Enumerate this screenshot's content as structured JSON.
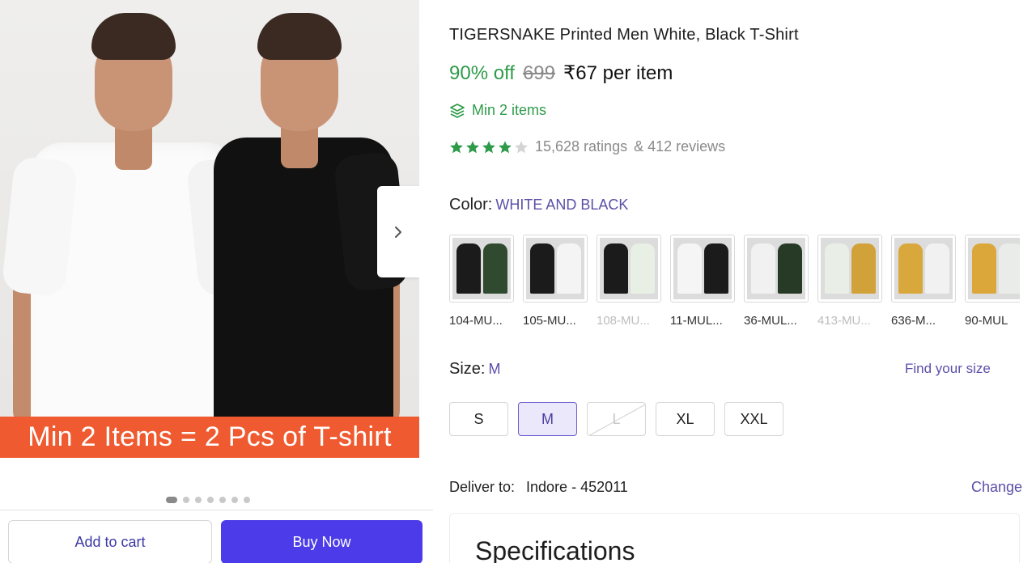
{
  "product": {
    "title": "TIGERSNAKE Printed Men White, Black T-Shirt",
    "discount": "90% off",
    "mrp": "699",
    "price": "₹67 per item",
    "min_items": "Min 2 items",
    "rating_value": 4,
    "rating_max": 5,
    "ratings_count": "15,628 ratings",
    "reviews_count": "& 412 reviews",
    "banner_text": "Min 2 Items = 2 Pcs of T-shirt"
  },
  "gallery": {
    "image_count": 7,
    "active_index": 0
  },
  "color": {
    "label": "Color:",
    "selected": "WHITE AND BLACK",
    "options": [
      {
        "name": "104-MU...",
        "available": true,
        "left": "#1b1b1b",
        "right": "#2f4a2f"
      },
      {
        "name": "105-MU...",
        "available": true,
        "left": "#1b1b1b",
        "right": "#f4f4f4"
      },
      {
        "name": "108-MU...",
        "available": false,
        "left": "#1b1b1b",
        "right": "#e8efe4"
      },
      {
        "name": "11-MUL...",
        "available": true,
        "left": "#f5f5f5",
        "right": "#1b1b1b"
      },
      {
        "name": "36-MUL...",
        "available": true,
        "left": "#f1f1f1",
        "right": "#263a26"
      },
      {
        "name": "413-MU...",
        "available": false,
        "left": "#e9efe6",
        "right": "#d1a13a"
      },
      {
        "name": "636-M...",
        "available": true,
        "left": "#d9a83c",
        "right": "#f1f1f1"
      },
      {
        "name": "90-MUL",
        "available": true,
        "left": "#dba73a",
        "right": "#e9ece8"
      }
    ]
  },
  "size": {
    "label": "Size:",
    "selected": "M",
    "find_size_label": "Find your size",
    "options": [
      {
        "label": "S",
        "state": "available"
      },
      {
        "label": "M",
        "state": "selected"
      },
      {
        "label": "L",
        "state": "disabled"
      },
      {
        "label": "XL",
        "state": "available"
      },
      {
        "label": "XXL",
        "state": "available"
      }
    ]
  },
  "delivery": {
    "label": "Deliver to:",
    "location": "Indore - 452011",
    "change_label": "Change"
  },
  "specifications": {
    "title": "Specifications"
  },
  "actions": {
    "add_to_cart": "Add to cart",
    "buy_now": "Buy Now"
  },
  "colors": {
    "accent": "#4b3be8",
    "green": "#2e9b4a",
    "link": "#5b4fa8",
    "banner": "#ef5a30"
  },
  "icons": {
    "next": "chevron-right-icon",
    "min_items": "stack-icon",
    "star": "star-icon"
  }
}
